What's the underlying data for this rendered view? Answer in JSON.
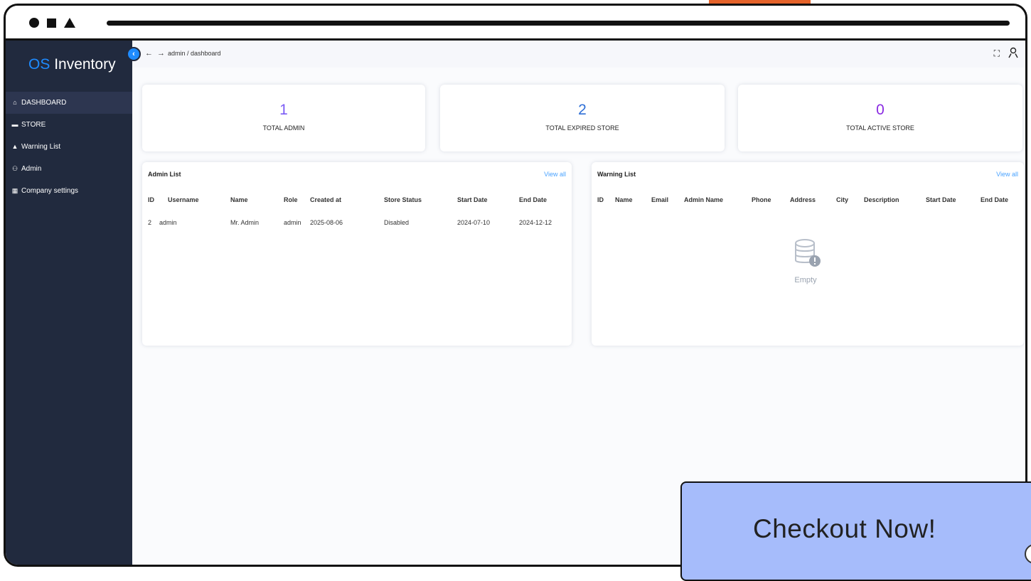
{
  "app": {
    "logo_prefix": "OS",
    "logo_suffix": "Inventory"
  },
  "sidebar": {
    "items": [
      {
        "label": "DASHBOARD",
        "icon": "home-icon",
        "active": true
      },
      {
        "label": "STORE",
        "icon": "store-icon",
        "active": false
      },
      {
        "label": "Warning List",
        "icon": "warning-icon",
        "active": false
      },
      {
        "label": "Admin",
        "icon": "users-icon",
        "active": false
      },
      {
        "label": "Company settings",
        "icon": "building-icon",
        "active": false
      }
    ]
  },
  "topbar": {
    "breadcrumb": "admin / dashboard"
  },
  "stats": [
    {
      "value": "1",
      "label": "TOTAL ADMIN",
      "color": "#7b5cf5"
    },
    {
      "value": "2",
      "label": "TOTAL EXPIRED STORE",
      "color": "#2f6fd6"
    },
    {
      "value": "0",
      "label": "TOTAL ACTIVE STORE",
      "color": "#8a2be2"
    }
  ],
  "admin_list": {
    "title": "Admin List",
    "view_all": "View all",
    "columns": [
      "ID",
      "Username",
      "Name",
      "Role",
      "Created at",
      "Store Status",
      "Start Date",
      "End Date"
    ],
    "rows": [
      [
        "2",
        "admin",
        "Mr. Admin",
        "admin",
        "2025-08-06",
        "Disabled",
        "2024-07-10",
        "2024-12-12"
      ]
    ]
  },
  "warning_list": {
    "title": "Warning List",
    "view_all": "View all",
    "columns": [
      "ID",
      "Name",
      "Email",
      "Admin Name",
      "Phone",
      "Address",
      "City",
      "Description",
      "Start Date",
      "End Date"
    ],
    "empty_text": "Empty"
  },
  "promo": {
    "label": "Checkout Now!",
    "background": "#a6bcfb"
  },
  "colors": {
    "sidebar": "#212a3e",
    "accent": "#1e8bff",
    "link": "#4aa3ff"
  }
}
